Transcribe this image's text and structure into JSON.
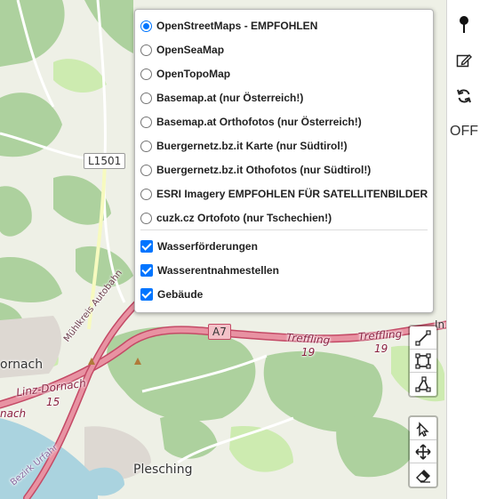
{
  "layers_panel": {
    "base_layers": [
      {
        "label": "OpenStreetMaps - EMPFOHLEN",
        "selected": true
      },
      {
        "label": "OpenSeaMap",
        "selected": false
      },
      {
        "label": "OpenTopoMap",
        "selected": false
      },
      {
        "label": "Basemap.at (nur Österreich!)",
        "selected": false
      },
      {
        "label": "Basemap.at Orthofotos (nur Österreich!)",
        "selected": false
      },
      {
        "label": "Buergernetz.bz.it Karte (nur Südtirol!)",
        "selected": false
      },
      {
        "label": "Buergernetz.bz.it Othofotos (nur Südtirol!)",
        "selected": false
      },
      {
        "label": "ESRI Imagery EMPFOHLEN FÜR SATELLITENBILDER",
        "selected": false
      },
      {
        "label": "cuzk.cz Ortofoto (nur Tschechien!)",
        "selected": false
      }
    ],
    "overlays": [
      {
        "label": "Wasserförderungen",
        "checked": true
      },
      {
        "label": "Wasserentnahmestellen",
        "checked": true
      },
      {
        "label": "Gebäude",
        "checked": true
      }
    ]
  },
  "right_toolbar": {
    "marker_icon": "map-pin-icon",
    "edit_icon": "edit-icon",
    "refresh_icon": "refresh-icon",
    "off_label": "OFF"
  },
  "draw_toolbar": {
    "tools": [
      "polyline-icon",
      "rectangle-icon",
      "polygon-icon"
    ],
    "edit_tools": [
      "select-cursor-icon",
      "move-icon",
      "eraser-icon"
    ]
  },
  "map_labels": {
    "road_l1501": "L1501",
    "road_a7": "A7",
    "treffling_1": "Treffling",
    "treffling_1_num": "19",
    "treffling_2": "Treffling",
    "treffling_2_num": "19",
    "linz_dornach": "Linz-Dornach",
    "linz_dornach_num": "15",
    "dornach": "ornach",
    "dornach_2": "nach",
    "muehlkreis": "Mühlkreis Autobahn",
    "plesching": "Plesching",
    "inn_fragment": "In",
    "bezirk": "Bezirk Urfahr"
  },
  "colors": {
    "accent": "#0075ff",
    "forest": "#add19e",
    "motorway": "#e892a2",
    "water": "#aad3df"
  }
}
